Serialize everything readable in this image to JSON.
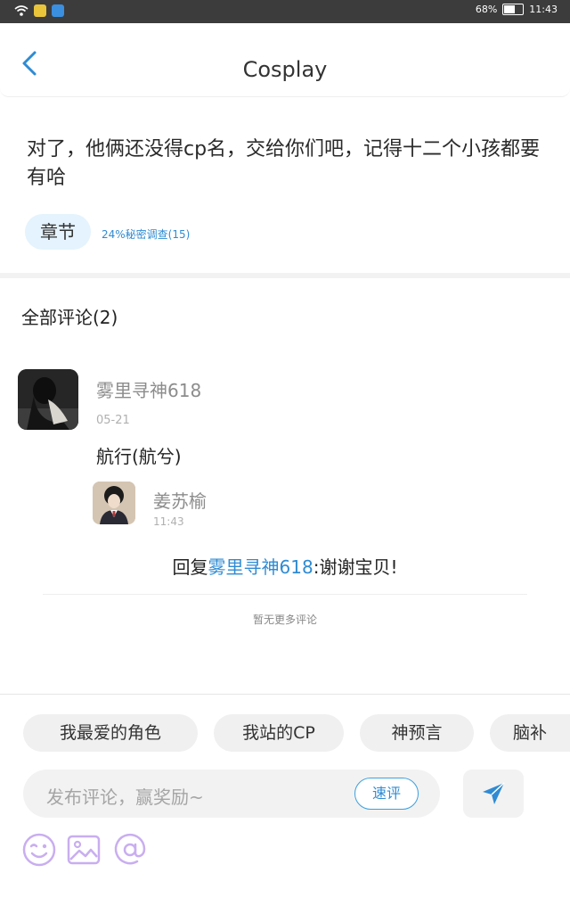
{
  "status_bar": {
    "battery": "68%",
    "battery_level": 0.68,
    "time": "11:43"
  },
  "header": {
    "title": "Cosplay"
  },
  "post": {
    "text": "对了，他俩还没得cp名，交给你们吧，记得十二个小孩都要有哈",
    "chapter_label": "章节",
    "poll_text": "24%秘密调查(15)"
  },
  "comments": {
    "title": "全部评论(2)",
    "items": [
      {
        "user": "雾里寻神618",
        "time": "05-21",
        "text": "航行(航兮)",
        "reply": {
          "user": "姜苏榆",
          "time": "11:43",
          "prefix": "回复",
          "mention": "雾里寻神618",
          "text": ":谢谢宝贝!"
        }
      }
    ],
    "no_more": "暂无更多评论"
  },
  "composer": {
    "tags": [
      "我最爱的角色",
      "我站的CP",
      "神预言",
      "脑补"
    ],
    "placeholder": "发布评论，赢奖励~",
    "quick_label": "速评",
    "tools": [
      "emoji-icon",
      "image-icon",
      "at-icon"
    ]
  },
  "colors": {
    "accent": "#2f8bd3",
    "pill_bg": "#e4f3fd",
    "tool_purple": "#c9aef0"
  }
}
